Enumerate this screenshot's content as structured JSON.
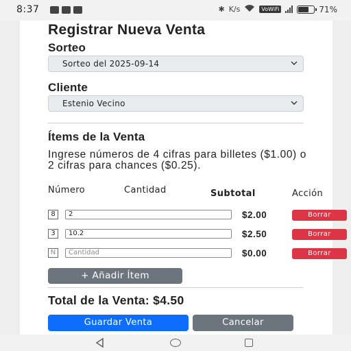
{
  "status_bar": {
    "time": "8:37",
    "left_icons": [
      "chat-icon",
      "gmail-icon",
      "news-icon"
    ],
    "right_icons": [
      "bluetooth-icon",
      "data-speed-icon",
      "wifi-icon",
      "vowifi-badge",
      "signal-icon",
      "battery-icon"
    ],
    "data_speed": "K/s",
    "vowifi_label": "VoWiFi",
    "battery_percent": "71%",
    "battery_level": 0.71
  },
  "form": {
    "title": "Registrar Nueva Venta",
    "sorteo_label": "Sorteo",
    "sorteo_value": "Sorteo del 2025-09-14",
    "cliente_label": "Cliente",
    "cliente_value": "Estenio Vecino",
    "items_heading": "Ítems de la Venta",
    "instructions": "Ingrese números de 4 cifras para billetes ($1.00) o 2 cifras para chances ($0.25).",
    "columns": {
      "numero": "Número",
      "cantidad": "Cantidad",
      "subtotal": "Subtotal",
      "accion": "Acción"
    },
    "items": [
      {
        "numero": "8",
        "cantidad": "2",
        "subtotal": "$2.00",
        "delete_label": "Borrar"
      },
      {
        "numero": "3",
        "cantidad": "10.2",
        "subtotal": "$2.50",
        "delete_label": "Borrar"
      },
      {
        "numero_placeholder": "N",
        "cantidad_placeholder": "Cantidad",
        "subtotal": "$0.00",
        "delete_label": "Borrar"
      }
    ],
    "add_item_label": "+ Añadir Ítem",
    "total_text": "Total de la Venta: $4.50",
    "save_label": "Guardar Venta",
    "cancel_label": "Cancelar"
  },
  "colors": {
    "primary": "#0d6efd",
    "secondary": "#6c757d",
    "danger": "#dc3545"
  }
}
